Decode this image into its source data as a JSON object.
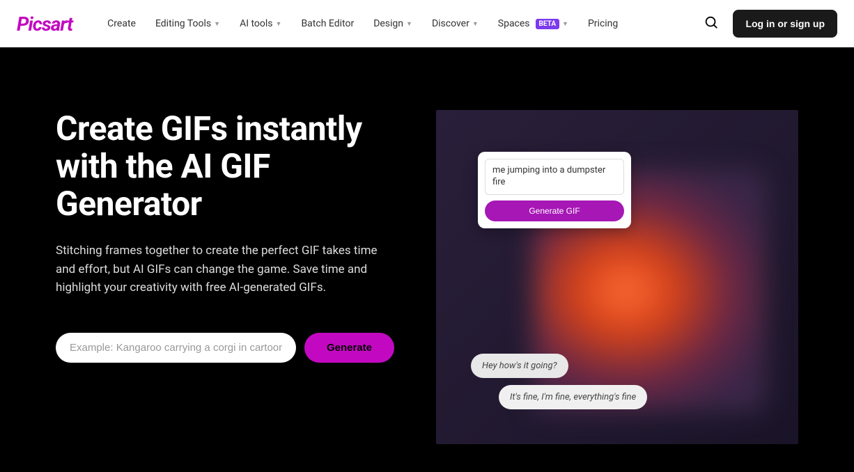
{
  "brand": "Picsart",
  "nav": {
    "items": [
      {
        "label": "Create",
        "dropdown": false
      },
      {
        "label": "Editing Tools",
        "dropdown": true
      },
      {
        "label": "AI tools",
        "dropdown": true
      },
      {
        "label": "Batch Editor",
        "dropdown": false
      },
      {
        "label": "Design",
        "dropdown": true
      },
      {
        "label": "Discover",
        "dropdown": true
      },
      {
        "label": "Spaces",
        "dropdown": true,
        "badge": "BETA"
      },
      {
        "label": "Pricing",
        "dropdown": false
      }
    ]
  },
  "login_label": "Log in or sign up",
  "hero": {
    "title": "Create GIFs instantly with the AI GIF Generator",
    "description": "Stitching frames together to create the perfect GIF takes time and effort, but AI GIFs can change the game. Save time and highlight your creativity with free AI-generated GIFs.",
    "input_placeholder": "Example: Kangaroo carrying a corgi in cartoon style",
    "generate_label": "Generate"
  },
  "demo": {
    "prompt_text": "me jumping into a dumpster fire",
    "generate_label": "Generate GIF",
    "bubble1": "Hey how's it going?",
    "bubble2": "It's fine, I'm fine, everything's fine"
  }
}
